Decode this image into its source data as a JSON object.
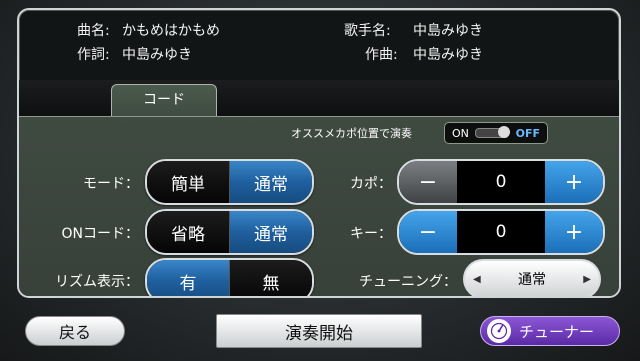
{
  "song_info": {
    "title_label": "曲名:",
    "title_value": "かもめはかもめ",
    "singer_label": "歌手名:",
    "singer_value": "中島みゆき",
    "lyricist_label": "作詞:",
    "lyricist_value": "中島みゆき",
    "composer_label": "作曲:",
    "composer_value": "中島みゆき"
  },
  "tab": {
    "label": "コード"
  },
  "capo_recommend": {
    "label": "オススメカポ位置で演奏",
    "on_label": "ON",
    "off_label": "OFF",
    "state": "OFF"
  },
  "mode": {
    "label": "モード：",
    "options": [
      "簡単",
      "通常"
    ],
    "selected": "通常"
  },
  "on_chord": {
    "label": "ONコード：",
    "options": [
      "省略",
      "通常"
    ],
    "selected": "通常"
  },
  "rhythm": {
    "label": "リズム表示：",
    "options": [
      "有",
      "無"
    ],
    "selected": "有"
  },
  "capo": {
    "label": "カポ：",
    "minus": "−",
    "value": "0",
    "plus": "+"
  },
  "key": {
    "label": "キー：",
    "minus": "−",
    "value": "0",
    "plus": "+"
  },
  "tuning": {
    "label": "チューニング：",
    "value": "通常",
    "left_arrow": "◀",
    "right_arrow": "▶"
  },
  "buttons": {
    "back": "戻る",
    "start": "演奏開始",
    "tuner": "チューナー"
  },
  "colors": {
    "selected_blue": "#1f5f9e",
    "plus_blue": "#1b6fb8",
    "tuner_purple": "#6c3bbd",
    "panel_green": "#3b463d"
  }
}
